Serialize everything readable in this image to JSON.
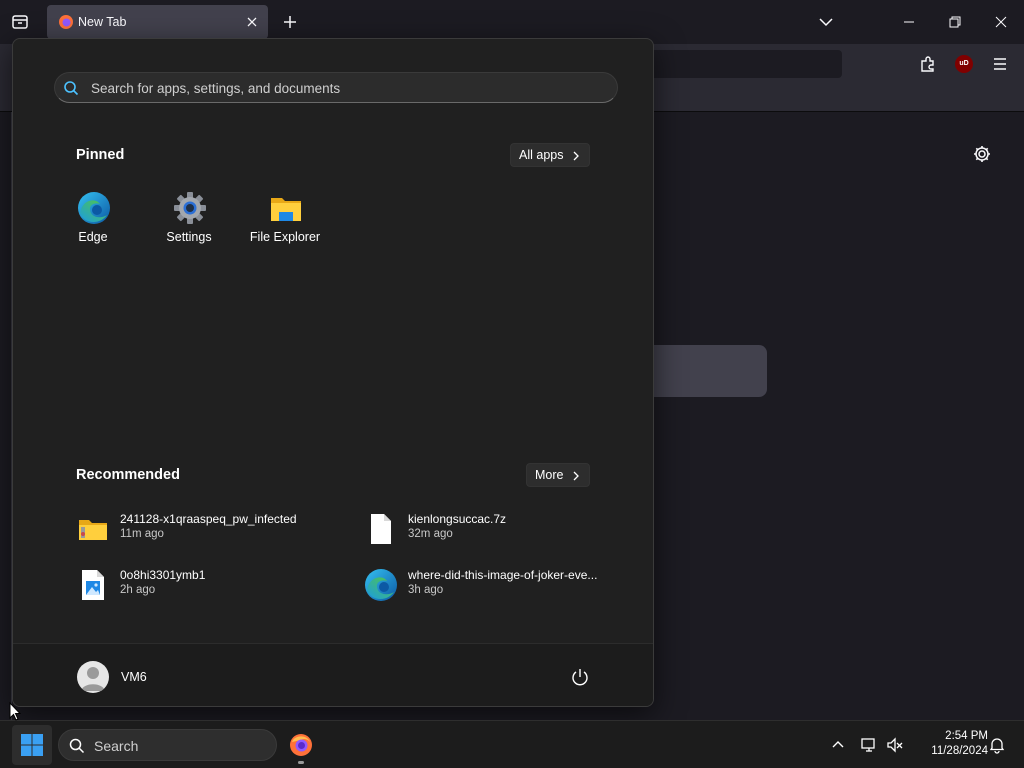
{
  "browser": {
    "tab_title": "New Tab",
    "addons": {
      "ublock_label": "uD"
    }
  },
  "start_menu": {
    "search_placeholder": "Search for apps, settings, and documents",
    "pinned_title": "Pinned",
    "all_apps_label": "All apps",
    "pinned_apps": [
      {
        "label": "Edge",
        "icon": "edge-icon"
      },
      {
        "label": "Settings",
        "icon": "settings-gear-icon"
      },
      {
        "label": "File Explorer",
        "icon": "file-explorer-icon"
      }
    ],
    "recommended_title": "Recommended",
    "more_label": "More",
    "recommended": [
      {
        "name": "241128-x1qraaspeq_pw_infected",
        "time": "11m ago",
        "icon": "zip-folder-icon"
      },
      {
        "name": "kienlongsuccac.7z",
        "time": "32m ago",
        "icon": "blank-file-icon"
      },
      {
        "name": "0o8hi3301ymb1",
        "time": "2h ago",
        "icon": "image-file-icon"
      },
      {
        "name": "where-did-this-image-of-joker-eve...",
        "time": "3h ago",
        "icon": "edge-icon"
      }
    ],
    "user_name": "VM6"
  },
  "taskbar": {
    "search_label": "Search",
    "time": "2:54 PM",
    "date": "11/28/2024"
  },
  "colors": {
    "accent_windows": "#3aa0f3",
    "start_bg": "#202020",
    "taskbar_bg": "#1c1c1c",
    "firefox_tab": "#42414d"
  }
}
